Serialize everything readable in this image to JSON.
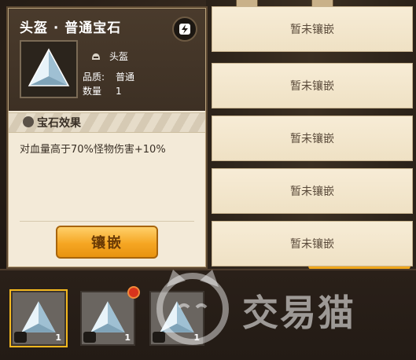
{
  "info_panel": {
    "title": "头盔 · 普通宝石",
    "slot_label": "头盔",
    "quality_key": "品质:",
    "quality_value": "普通",
    "count_key": "数量",
    "count_value": "1",
    "effect_title": "宝石效果",
    "effect_text": "对血量高于70%怪物伤害+10%",
    "inlay_button": "镶嵌"
  },
  "slots": [
    {
      "label": "暂未镶嵌"
    },
    {
      "label": "暂未镶嵌"
    },
    {
      "label": "暂未镶嵌"
    },
    {
      "label": "暂未镶嵌"
    },
    {
      "label": "暂未镶嵌"
    }
  ],
  "inventory": [
    {
      "count": "1",
      "type_icon": "helmet-icon",
      "selected": true
    },
    {
      "count": "1",
      "type_icon": "boot-icon",
      "selected": false,
      "badge": true
    },
    {
      "count": "1",
      "type_icon": "glove-icon",
      "selected": false
    }
  ],
  "watermark": {
    "text": "交易猫"
  },
  "colors": {
    "accent": "#f5a623",
    "panel": "#f3ead8",
    "header": "#3d3024",
    "selection": "#f3b81f"
  }
}
